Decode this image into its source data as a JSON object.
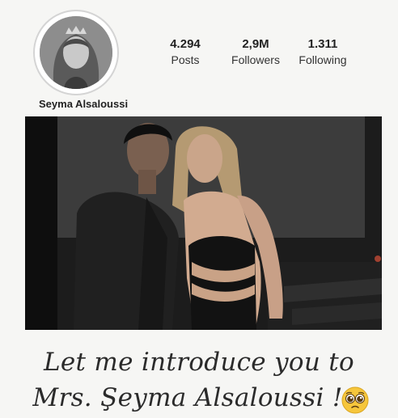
{
  "profile": {
    "username": "Seyma Alsaloussi",
    "stats": [
      {
        "value": "4.294",
        "label": "Posts"
      },
      {
        "value": "2,9M",
        "label": "Followers"
      },
      {
        "value": "1.311",
        "label": "Following"
      }
    ]
  },
  "caption": {
    "line1": "Let me introduce you to",
    "line2": "Mrs. Şeyma Alsaloussi !"
  },
  "icons": {
    "emoji": "pleading-face-emoji"
  }
}
